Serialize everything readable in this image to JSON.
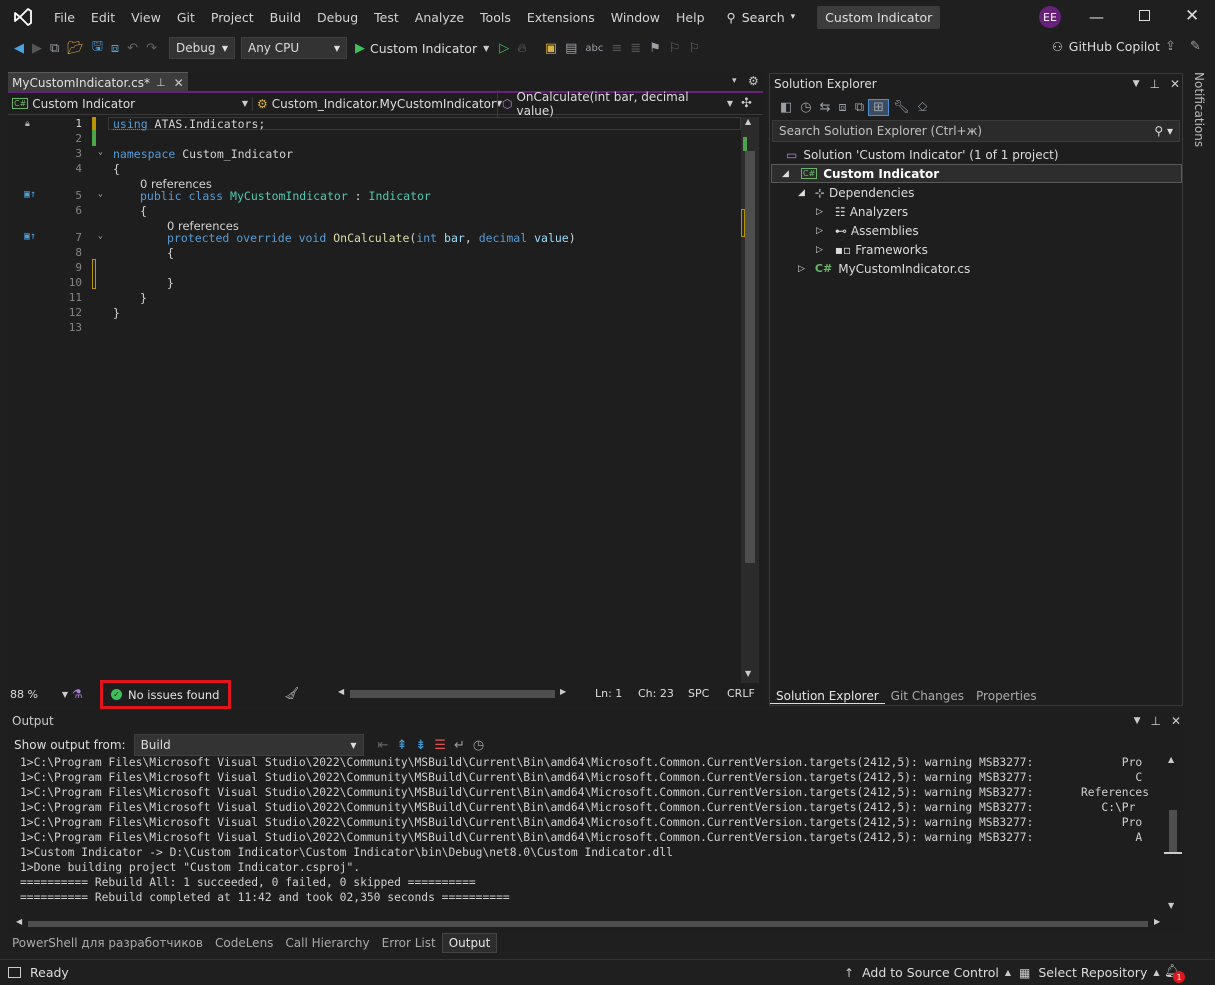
{
  "menu": [
    "File",
    "Edit",
    "View",
    "Git",
    "Project",
    "Build",
    "Debug",
    "Test",
    "Analyze",
    "Tools",
    "Extensions",
    "Window",
    "Help"
  ],
  "search_label": "Search",
  "solution_title": "Custom Indicator",
  "user_initials": "EE",
  "toolbar": {
    "config": "Debug",
    "platform": "Any CPU",
    "run_label": "Custom Indicator",
    "copilot": "GitHub Copilot"
  },
  "editor": {
    "tab": "MyCustomIndicator.cs*",
    "nav_project": "Custom Indicator",
    "nav_class": "Custom_Indicator.MyCustomIndicator",
    "nav_member": "OnCalculate(int bar, decimal value)",
    "line_numbers": [
      "1",
      "2",
      "3",
      "4",
      "5",
      "6",
      "7",
      "8",
      "9",
      "10",
      "11",
      "12",
      "13"
    ],
    "code": {
      "l1a": "using",
      "l1b": " ATAS.Indicators;",
      "l3a": "namespace",
      "l3b": " Custom_Indicator",
      "l4": "{",
      "ref1": "0 references",
      "l5a": "public",
      "l5b": "class",
      "l5c": "MyCustomIndicator",
      "l5d": " : ",
      "l5e": "Indicator",
      "l6": "{",
      "ref2": "0 references",
      "l7a": "protected",
      "l7b": "override",
      "l7c": "void",
      "l7d": "OnCalculate",
      "l7e": "(",
      "l7f": "int",
      "l7g": "bar",
      "l7h": ", ",
      "l7i": "decimal",
      "l7j": "value",
      "l7k": ")",
      "l8": "{",
      "l10": "}",
      "l11": "}",
      "l12": "}"
    },
    "zoom": "88 %",
    "issues": "No issues found",
    "ln": "Ln: 1",
    "ch": "Ch: 23",
    "spc": "SPC",
    "crlf": "CRLF"
  },
  "solution_explorer": {
    "title": "Solution Explorer",
    "search_placeholder": "Search Solution Explorer (Ctrl+ж)",
    "solution": "Solution 'Custom Indicator' (1 of 1 project)",
    "project": "Custom Indicator",
    "dependencies": "Dependencies",
    "analyzers": "Analyzers",
    "assemblies": "Assemblies",
    "frameworks": "Frameworks",
    "file": "MyCustomIndicator.cs",
    "tabs": [
      "Solution Explorer",
      "Git Changes",
      "Properties"
    ]
  },
  "notifications": "Notifications",
  "output": {
    "title": "Output",
    "show_from_label": "Show output from:",
    "source": "Build",
    "lines": [
      "1>C:\\Program Files\\Microsoft Visual Studio\\2022\\Community\\MSBuild\\Current\\Bin\\amd64\\Microsoft.Common.CurrentVersion.targets(2412,5): warning MSB3277:             Pro",
      "1>C:\\Program Files\\Microsoft Visual Studio\\2022\\Community\\MSBuild\\Current\\Bin\\amd64\\Microsoft.Common.CurrentVersion.targets(2412,5): warning MSB3277:               C",
      "1>C:\\Program Files\\Microsoft Visual Studio\\2022\\Community\\MSBuild\\Current\\Bin\\amd64\\Microsoft.Common.CurrentVersion.targets(2412,5): warning MSB3277:       References",
      "1>C:\\Program Files\\Microsoft Visual Studio\\2022\\Community\\MSBuild\\Current\\Bin\\amd64\\Microsoft.Common.CurrentVersion.targets(2412,5): warning MSB3277:          C:\\Pr",
      "1>C:\\Program Files\\Microsoft Visual Studio\\2022\\Community\\MSBuild\\Current\\Bin\\amd64\\Microsoft.Common.CurrentVersion.targets(2412,5): warning MSB3277:             Pro",
      "1>C:\\Program Files\\Microsoft Visual Studio\\2022\\Community\\MSBuild\\Current\\Bin\\amd64\\Microsoft.Common.CurrentVersion.targets(2412,5): warning MSB3277:               A",
      "1>Custom Indicator -> D:\\Custom Indicator\\Custom Indicator\\bin\\Debug\\net8.0\\Custom Indicator.dll",
      "1>Done building project \"Custom Indicator.csproj\".",
      "========== Rebuild All: 1 succeeded, 0 failed, 0 skipped ==========",
      "========== Rebuild completed at 11:42 and took 02,350 seconds =========="
    ]
  },
  "bottom_tabs": [
    "PowerShell для разработчиков",
    "CodeLens",
    "Call Hierarchy",
    "Error List",
    "Output"
  ],
  "status": {
    "ready": "Ready",
    "source_control": "Add to Source Control",
    "repository": "Select Repository",
    "badge": "1"
  }
}
